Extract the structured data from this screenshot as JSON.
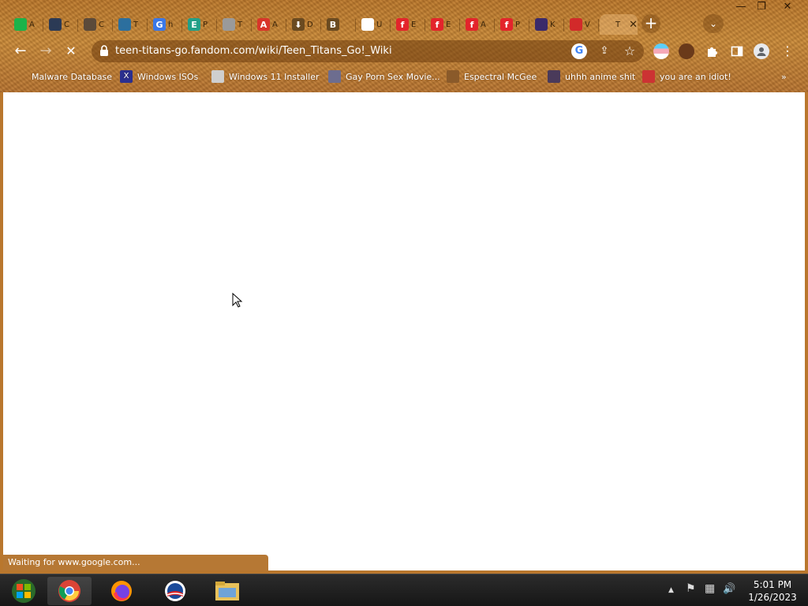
{
  "window": {
    "controls": {
      "minimize": "—",
      "maximize": "❐",
      "close": "✕"
    }
  },
  "tabs": [
    {
      "glyph": "",
      "label": "A",
      "color": "#1bb34a"
    },
    {
      "glyph": "",
      "label": "C",
      "color": "#2b3a55"
    },
    {
      "glyph": "",
      "label": "C",
      "color": "#5b4a3a"
    },
    {
      "glyph": "",
      "label": "T",
      "color": "#2c6f9e"
    },
    {
      "glyph": "G",
      "label": "h",
      "color": "#3b78e7"
    },
    {
      "glyph": "E",
      "label": "P",
      "color": "#21a088"
    },
    {
      "glyph": "",
      "label": "T",
      "color": "#9a9a9a"
    },
    {
      "glyph": "A",
      "label": "A",
      "color": "#d8352a"
    },
    {
      "glyph": "⬇",
      "label": "D",
      "color": "#6a4a20"
    },
    {
      "glyph": "B",
      "label": "",
      "color": "#6a4a20"
    },
    {
      "glyph": "G",
      "label": "U",
      "color": "#ffffff"
    },
    {
      "glyph": "f",
      "label": "E",
      "color": "#e3242b"
    },
    {
      "glyph": "f",
      "label": "E",
      "color": "#e3242b"
    },
    {
      "glyph": "f",
      "label": "A",
      "color": "#e3242b"
    },
    {
      "glyph": "f",
      "label": "P",
      "color": "#e3242b"
    },
    {
      "glyph": "",
      "label": "K",
      "color": "#3b2a6a"
    },
    {
      "glyph": "",
      "label": "V",
      "color": "#d22a2a"
    },
    {
      "glyph": "",
      "label": "T",
      "color": "transparent"
    }
  ],
  "new_tab": "+",
  "tab_search": "⌄",
  "toolbar": {
    "back": "←",
    "forward": "→",
    "reload_stop": "✕",
    "url": "teen-titans-go.fandom.com/wiki/Teen_Titans_Go!_Wiki",
    "google_icon": "G",
    "share_icon": "⇪",
    "star_icon": "☆",
    "menu_icon": "⋮"
  },
  "bookmarks": [
    {
      "label": "Malware Database",
      "icon": "",
      "color": "transparent"
    },
    {
      "label": "Windows ISOs",
      "icon": "X",
      "color": "#2a2f8f"
    },
    {
      "label": "Windows 11 Installer",
      "icon": "",
      "color": "#cfcfcf"
    },
    {
      "label": "Gay Porn Sex Movie...",
      "icon": "",
      "color": "#6d6d8f"
    },
    {
      "label": "Espectral McGee",
      "icon": "",
      "color": "#8a5a2a"
    },
    {
      "label": "uhhh anime shit",
      "icon": "",
      "color": "#4a3a5a"
    },
    {
      "label": "you are an idiot!",
      "icon": "",
      "color": "#c33"
    }
  ],
  "bookmarks_overflow": "»",
  "status": "Waiting for www.google.com...",
  "taskbar": {
    "apps": [
      "start-orb",
      "chrome",
      "firefox",
      "obama-campaign",
      "file-explorer"
    ],
    "tray": {
      "chevron": "▲",
      "flag": "⚑",
      "network": "▦",
      "volume": "🔊"
    },
    "time": "5:01 PM",
    "date": "1/26/2023"
  }
}
